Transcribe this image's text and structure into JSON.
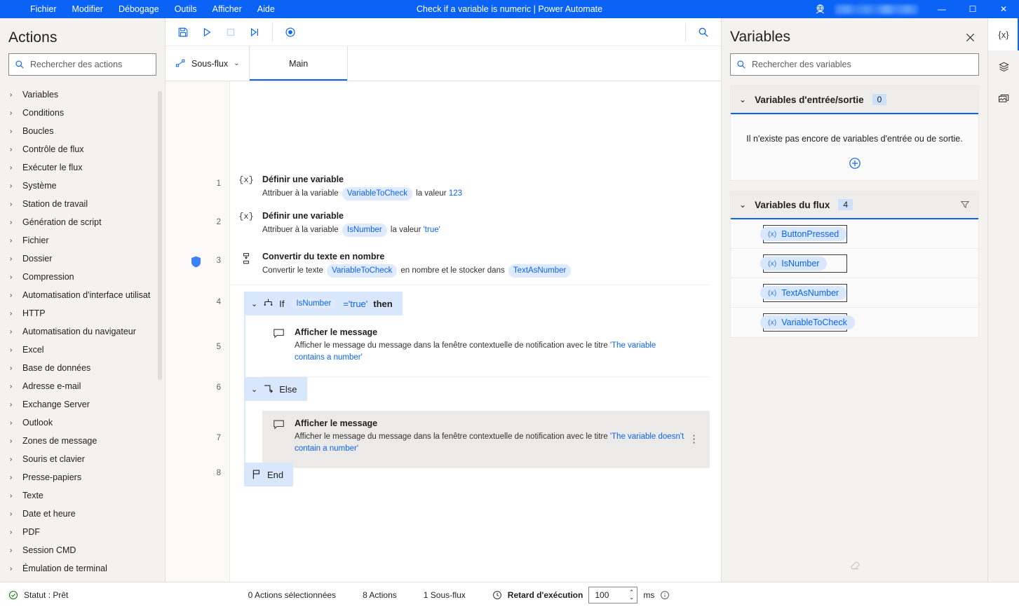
{
  "titlebar": {
    "menu": [
      "Fichier",
      "Modifier",
      "Débogage",
      "Outils",
      "Afficher",
      "Aide"
    ],
    "title": "Check if a variable is numeric | Power Automate",
    "globe_icon": "globe-icon",
    "minimize": "—",
    "maximize": "☐",
    "close": "✕"
  },
  "actions_panel": {
    "title": "Actions",
    "search_placeholder": "Rechercher des actions",
    "search_value": "",
    "items": [
      "Variables",
      "Conditions",
      "Boucles",
      "Contrôle de flux",
      "Exécuter le flux",
      "Système",
      "Station de travail",
      "Génération de script",
      "Fichier",
      "Dossier",
      "Compression",
      "Automatisation d'interface utilisat",
      "HTTP",
      "Automatisation du navigateur",
      "Excel",
      "Base de données",
      "Adresse e-mail",
      "Exchange Server",
      "Outlook",
      "Zones de message",
      "Souris et clavier",
      "Presse-papiers",
      "Texte",
      "Date et heure",
      "PDF",
      "Session CMD",
      "Émulation de terminal"
    ]
  },
  "toolbar": {
    "save": "save-icon",
    "run": "run-icon",
    "stop": "stop-icon",
    "step": "step-icon",
    "record": "record-icon",
    "find": "find-icon"
  },
  "tabs": {
    "subflow_label": "Sous-flux",
    "items": [
      {
        "label": "Main",
        "active": true
      }
    ]
  },
  "flow": {
    "steps": [
      {
        "number": "1",
        "kind": "action",
        "icon": "variable-icon",
        "title": "Définir une variable",
        "desc": [
          {
            "t": "text",
            "v": "Attribuer à la variable "
          },
          {
            "t": "pill",
            "v": "VariableToCheck"
          },
          {
            "t": "text",
            "v": " la valeur "
          },
          {
            "t": "lit",
            "v": "123"
          }
        ],
        "shield": false,
        "hovered": false
      },
      {
        "number": "2",
        "kind": "action",
        "icon": "variable-icon",
        "title": "Définir une variable",
        "desc": [
          {
            "t": "text",
            "v": "Attribuer à la variable "
          },
          {
            "t": "pill",
            "v": "IsNumber"
          },
          {
            "t": "text",
            "v": " la valeur "
          },
          {
            "t": "lit",
            "v": "'true'"
          }
        ],
        "shield": false,
        "hovered": false
      },
      {
        "number": "3",
        "kind": "action",
        "icon": "convert-icon",
        "title": "Convertir du texte en nombre",
        "desc": [
          {
            "t": "text",
            "v": "Convertir le texte "
          },
          {
            "t": "pill",
            "v": "VariableToCheck"
          },
          {
            "t": "text",
            "v": " en nombre et le stocker dans "
          },
          {
            "t": "pill",
            "v": "TextAsNumber"
          }
        ],
        "shield": true,
        "hovered": false
      },
      {
        "number": "4",
        "kind": "condition",
        "icon": "if-icon",
        "parts": [
          {
            "t": "text",
            "v": "If"
          },
          {
            "t": "pill",
            "v": "IsNumber"
          },
          {
            "t": "lit",
            "v": "='true'"
          },
          {
            "t": "bold",
            "v": "then"
          }
        ],
        "shield": false
      },
      {
        "number": "5",
        "kind": "action",
        "indent": 1,
        "icon": "message-icon",
        "title": "Afficher le message",
        "desc": [
          {
            "t": "text",
            "v": "Afficher le message  du message dans la fenêtre contextuelle de notification avec le titre "
          },
          {
            "t": "lit",
            "v": "'The variable contains a number'"
          }
        ],
        "shield": false,
        "hovered": false
      },
      {
        "number": "6",
        "kind": "condition",
        "icon": "else-icon",
        "parts": [
          {
            "t": "text",
            "v": "Else"
          }
        ],
        "shield": false
      },
      {
        "number": "7",
        "kind": "action",
        "indent": 1,
        "icon": "message-icon",
        "title": "Afficher le message",
        "desc": [
          {
            "t": "text",
            "v": "Afficher le message  du message dans la fenêtre contextuelle de notification avec le titre "
          },
          {
            "t": "lit",
            "v": "'The variable doesn't contain a number'"
          }
        ],
        "shield": false,
        "hovered": true
      },
      {
        "number": "8",
        "kind": "condition",
        "icon": "end-icon",
        "parts": [
          {
            "t": "text",
            "v": "End"
          }
        ],
        "shield": false
      }
    ]
  },
  "variables_panel": {
    "title": "Variables",
    "close_icon": "close-icon",
    "search_placeholder": "Rechercher des variables",
    "search_value": "",
    "io_group": {
      "label": "Variables d'entrée/sortie",
      "count": "0",
      "empty_text": "Il n'existe pas encore de variables d'entrée ou de sortie.",
      "add_icon": "plus-circle-icon"
    },
    "flow_group": {
      "label": "Variables du flux",
      "count": "4",
      "filter_icon": "funnel-icon",
      "variables": [
        {
          "name": "ButtonPressed",
          "value": ""
        },
        {
          "name": "IsNumber",
          "value": ""
        },
        {
          "name": "TextAsNumber",
          "value": ""
        },
        {
          "name": "VariableToCheck",
          "value": ""
        }
      ]
    },
    "eraser_icon": "eraser-icon"
  },
  "rail": {
    "items": [
      {
        "name": "variables-tab",
        "icon": "{x}",
        "active": true
      },
      {
        "name": "ui-elements-tab",
        "icon": "layers-icon",
        "active": false
      },
      {
        "name": "images-tab",
        "icon": "images-icon",
        "active": false
      }
    ]
  },
  "statusbar": {
    "status": "Statut : Prêt",
    "status_icon": "check-circle-icon",
    "selected_actions": "0 Actions sélectionnées",
    "total_actions": "8 Actions",
    "subflows": "1 Sous-flux",
    "delay_icon": "clock-icon",
    "delay_label": "Retard d'exécution",
    "delay_value": "100",
    "delay_unit": "ms",
    "info_icon": "info-icon"
  },
  "colors": {
    "accent": "#0b63f6",
    "pill_bg": "#dfeaff",
    "condition_bg": "#d9e7fd",
    "panel_bg": "#f3f2f1",
    "ok_green": "#107c10"
  }
}
